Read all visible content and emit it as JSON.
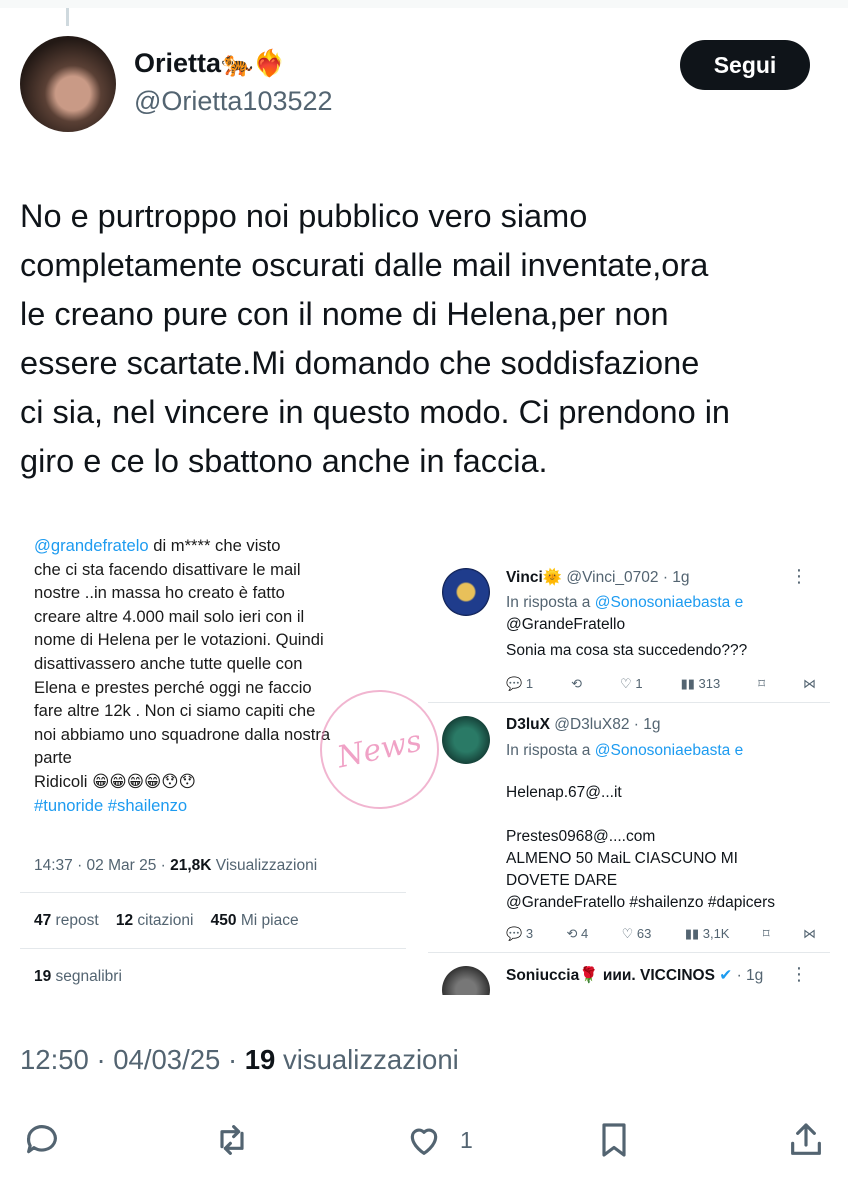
{
  "author": {
    "name": "Orietta",
    "name_emoji": "🐅❤️‍🔥",
    "handle": "@Orietta103522",
    "follow_label": "Segui"
  },
  "tweet": {
    "lines": [
      "No e purtroppo noi pubblico vero siamo",
      "completamente oscurati dalle mail inventate,ora",
      "le creano pure con il nome di Helena,per non",
      "essere scartate.Mi domando che soddisfazione",
      "ci sia, nel vincere in questo modo. Ci prendono in",
      "giro e ce lo sbattono anche in faccia."
    ],
    "timestamp": "12:50 · 04/03/25 · ",
    "views_count": "19",
    "views_label": " visualizzazioni",
    "like_count": "1"
  },
  "embedded_left": {
    "mention": "@grandefratelo",
    "text_first": " di m**** che visto",
    "lines": [
      "che ci sta facendo disattivare le mail",
      "nostre ..in massa ho creato è fatto",
      "creare altre 4.000 mail  solo ieri con il",
      "nome di Helena per le votazioni. Quindi",
      "disattivassero anche tutte quelle con",
      "Elena e prestes  perché oggi ne faccio",
      "fare altre 12k . Non ci siamo capiti che",
      "noi abbiamo uno squadrone dalla nostra",
      "parte",
      "Ridicoli 😁😁😁😁😯😯"
    ],
    "hashtags": "#tunoride #shailenzo",
    "time": "14:37 · 02 Mar 25 · ",
    "views_count": "21,8K",
    "views_label": " Visualizzazioni",
    "reposts_count": "47",
    "reposts_label": " repost",
    "quotes_count": "12",
    "quotes_label": " citazioni",
    "likes_count": "450",
    "likes_label": " Mi piace",
    "bookmarks_count": "19",
    "bookmarks_label": " segnalibri"
  },
  "embedded_right": {
    "reply1": {
      "name": "Vinci🌞",
      "handle_time": " @Vinci_0702 · 1g",
      "in_reply_prefix": "In risposta a ",
      "in_reply_mentions": "@Sonosoniaebasta e",
      "in_reply_mentions2": "@GrandeFratello",
      "text": "Sonia ma cosa sta succedendo???",
      "replies": "1",
      "reposts": "",
      "likes": "1",
      "views": "313"
    },
    "reply2": {
      "name": "D3luX",
      "handle_time": " @D3luX82 · 1g",
      "in_reply_prefix": "In risposta a ",
      "in_reply_mentions": "@Sonosoniaebasta e",
      "text_lines": [
        "Helenap.67@...it",
        "",
        "Prestes0968@....com",
        "ALMENO 50 MaiL CIASCUNO MI",
        "DOVETE DARE"
      ],
      "hashtags": "@GrandeFratello #shailenzo #dapicers",
      "replies": "3",
      "reposts": "4",
      "likes": "63",
      "views": "3,1K"
    },
    "reply3": {
      "name": "Soniuccia🌹 ᴎᴎᴎ. VICCINOS",
      "handle_time": " · 1g"
    }
  },
  "watermark": "News",
  "colors": {
    "accent": "#1d9bf0",
    "text": "#0f1419",
    "muted": "#536471",
    "button": "#0f1419"
  },
  "icons": [
    "reply-icon",
    "repost-icon",
    "like-icon",
    "bookmark-icon",
    "share-icon",
    "more-icon",
    "verified-icon"
  ]
}
